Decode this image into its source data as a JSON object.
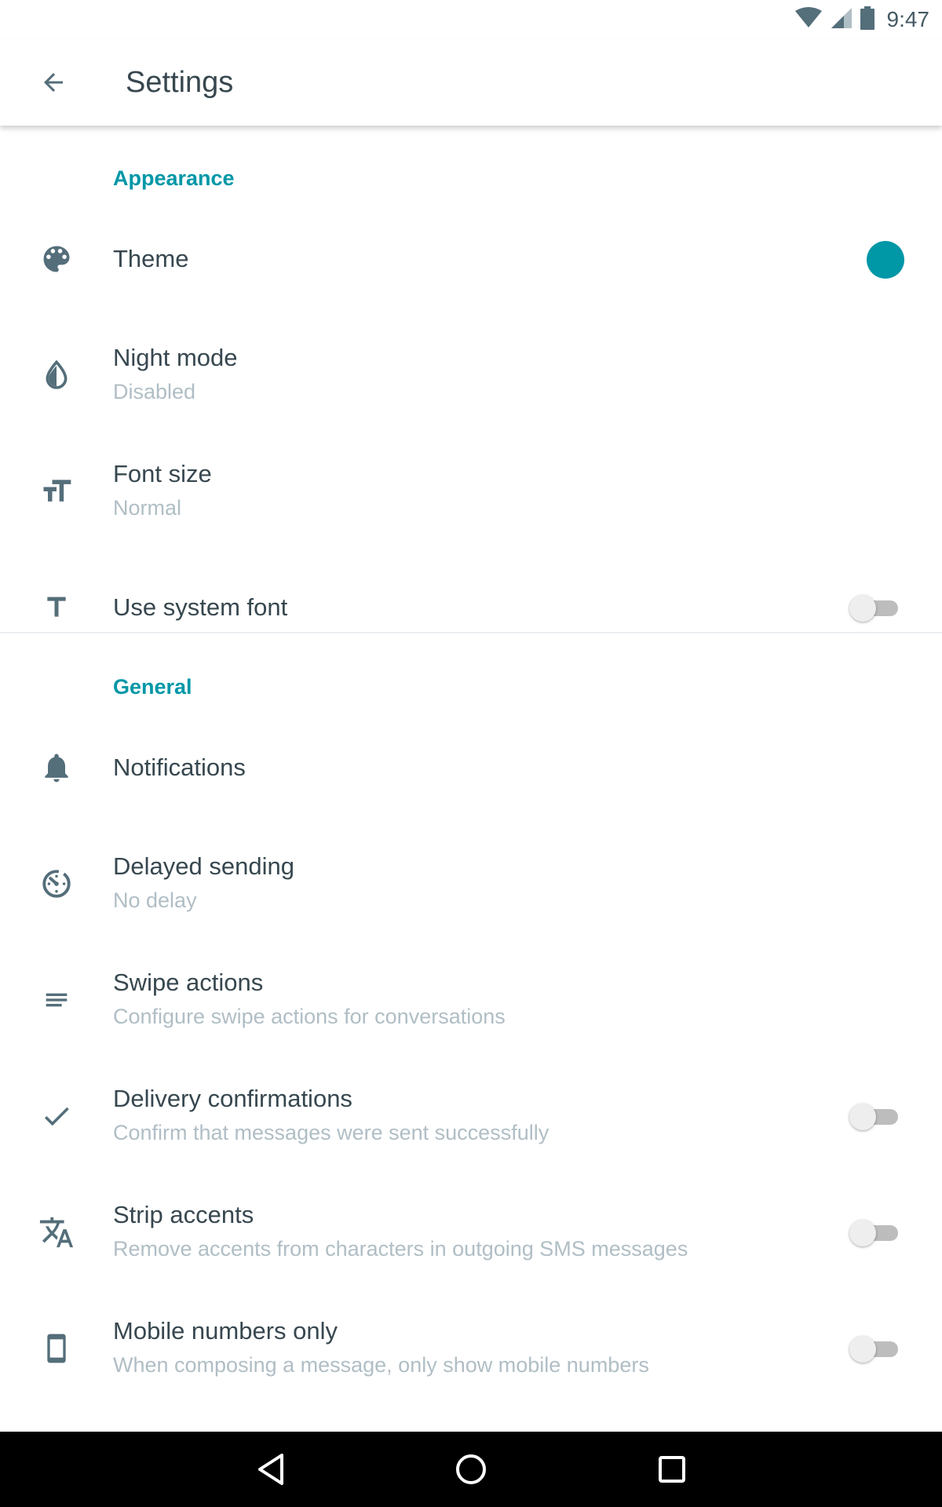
{
  "status_bar": {
    "time": "9:47",
    "icons": [
      "wifi-icon",
      "cell-signal-icon",
      "battery-icon"
    ]
  },
  "app_bar": {
    "title": "Settings",
    "back_icon": "back-arrow-icon"
  },
  "sections": {
    "appearance": {
      "header": "Appearance",
      "items": {
        "theme": {
          "title": "Theme",
          "icon": "palette-icon",
          "swatch_color": "#0097a7"
        },
        "night_mode": {
          "title": "Night mode",
          "summary": "Disabled",
          "icon": "night-mode-icon"
        },
        "font_size": {
          "title": "Font size",
          "summary": "Normal",
          "icon": "font-size-icon"
        },
        "system_font": {
          "title": "Use system font",
          "icon": "text-icon",
          "enabled": false
        }
      }
    },
    "general": {
      "header": "General",
      "items": {
        "notifications": {
          "title": "Notifications",
          "icon": "bell-icon"
        },
        "delayed_sending": {
          "title": "Delayed sending",
          "summary": "No delay",
          "icon": "timer-icon"
        },
        "swipe_actions": {
          "title": "Swipe actions",
          "summary": "Configure swipe actions for conversations",
          "icon": "swipe-lines-icon"
        },
        "delivery_confirmations": {
          "title": "Delivery confirmations",
          "summary": "Confirm that messages were sent successfully",
          "icon": "check-icon",
          "enabled": false
        },
        "strip_accents": {
          "title": "Strip accents",
          "summary": "Remove accents from characters in outgoing SMS messages",
          "icon": "translate-icon",
          "enabled": false
        },
        "mobile_only": {
          "title": "Mobile numbers only",
          "summary": "When composing a message, only show mobile numbers",
          "icon": "phone-icon",
          "enabled": false
        }
      }
    }
  },
  "colors": {
    "accent": "#0097a7",
    "text_primary": "#37474f",
    "text_secondary": "#b0bec5",
    "icon": "#546e7a"
  },
  "nav_bar": {
    "buttons": [
      "back-triangle-icon",
      "home-circle-icon",
      "recents-square-icon"
    ]
  }
}
